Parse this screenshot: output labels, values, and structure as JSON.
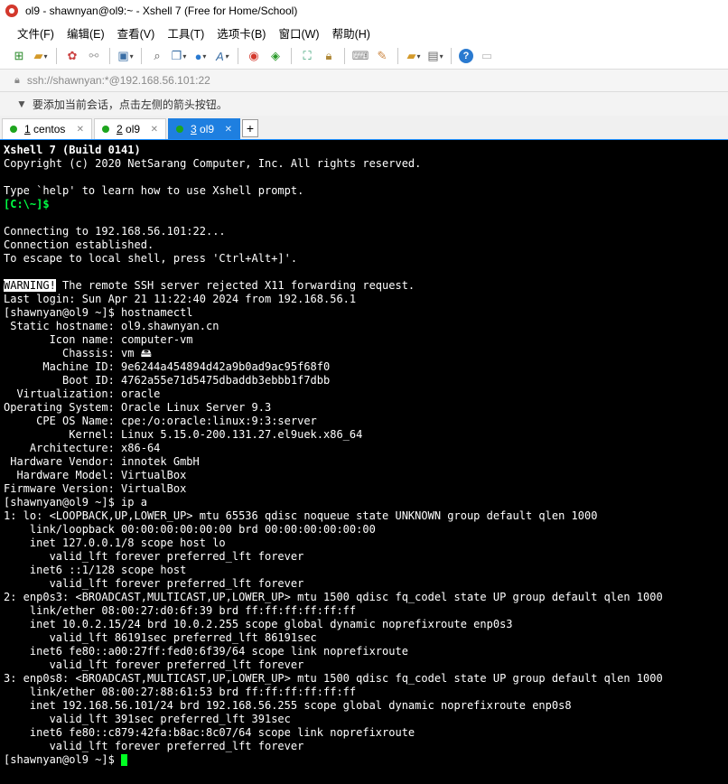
{
  "window": {
    "title": "ol9 - shawnyan@ol9:~ - Xshell 7 (Free for Home/School)"
  },
  "menu": [
    "文件(F)",
    "编辑(E)",
    "查看(V)",
    "工具(T)",
    "选项卡(B)",
    "窗口(W)",
    "帮助(H)"
  ],
  "address": {
    "text": "ssh://shawnyan:*@192.168.56.101:22"
  },
  "hint": {
    "text": "要添加当前会话，点击左侧的箭头按钮。"
  },
  "tabs": [
    {
      "num": "1",
      "label": "centos"
    },
    {
      "num": "2",
      "label": "ol9"
    },
    {
      "num": "3",
      "label": "ol9"
    }
  ],
  "tab_add": "+",
  "colors": {
    "accent": "#1e7fe0",
    "prompt_green": "#00ff44",
    "status_dot": "#1ea51e"
  },
  "terminal": {
    "banner": "Xshell 7 (Build 0141)",
    "copyright": "Copyright (c) 2020 NetSarang Computer, Inc. All rights reserved.",
    "help": "Type `help' to learn how to use Xshell prompt.",
    "local_prompt": "[C:\\~]$",
    "connecting": "Connecting to 192.168.56.101:22...",
    "established": "Connection established.",
    "escape": "To escape to local shell, press 'Ctrl+Alt+]'.",
    "warning_tag": "WARNING!",
    "warning_text": " The remote SSH server rejected X11 forwarding request.",
    "last_login": "Last login: Sun Apr 21 11:22:40 2024 from 192.168.56.1",
    "lines": [
      "[shawnyan@ol9 ~]$ hostnamectl",
      " Static hostname: ol9.shawnyan.cn",
      "       Icon name: computer-vm",
      "         Chassis: vm 🖴",
      "      Machine ID: 9e6244a454894d42a9b0ad9ac95f68f0",
      "         Boot ID: 4762a55e71d5475dbaddb3ebbb1f7dbb",
      "  Virtualization: oracle",
      "Operating System: Oracle Linux Server 9.3",
      "     CPE OS Name: cpe:/o:oracle:linux:9:3:server",
      "          Kernel: Linux 5.15.0-200.131.27.el9uek.x86_64",
      "    Architecture: x86-64",
      " Hardware Vendor: innotek GmbH",
      "  Hardware Model: VirtualBox",
      "Firmware Version: VirtualBox",
      "[shawnyan@ol9 ~]$ ip a",
      "1: lo: <LOOPBACK,UP,LOWER_UP> mtu 65536 qdisc noqueue state UNKNOWN group default qlen 1000",
      "    link/loopback 00:00:00:00:00:00 brd 00:00:00:00:00:00",
      "    inet 127.0.0.1/8 scope host lo",
      "       valid_lft forever preferred_lft forever",
      "    inet6 ::1/128 scope host",
      "       valid_lft forever preferred_lft forever",
      "2: enp0s3: <BROADCAST,MULTICAST,UP,LOWER_UP> mtu 1500 qdisc fq_codel state UP group default qlen 1000",
      "    link/ether 08:00:27:d0:6f:39 brd ff:ff:ff:ff:ff:ff",
      "    inet 10.0.2.15/24 brd 10.0.2.255 scope global dynamic noprefixroute enp0s3",
      "       valid_lft 86191sec preferred_lft 86191sec",
      "    inet6 fe80::a00:27ff:fed0:6f39/64 scope link noprefixroute",
      "       valid_lft forever preferred_lft forever",
      "3: enp0s8: <BROADCAST,MULTICAST,UP,LOWER_UP> mtu 1500 qdisc fq_codel state UP group default qlen 1000",
      "    link/ether 08:00:27:88:61:53 brd ff:ff:ff:ff:ff:ff",
      "    inet 192.168.56.101/24 brd 192.168.56.255 scope global dynamic noprefixroute enp0s8",
      "       valid_lft 391sec preferred_lft 391sec",
      "    inet6 fe80::c879:42fa:b8ac:8c07/64 scope link noprefixroute",
      "       valid_lft forever preferred_lft forever"
    ],
    "final_prompt": "[shawnyan@ol9 ~]$ "
  }
}
